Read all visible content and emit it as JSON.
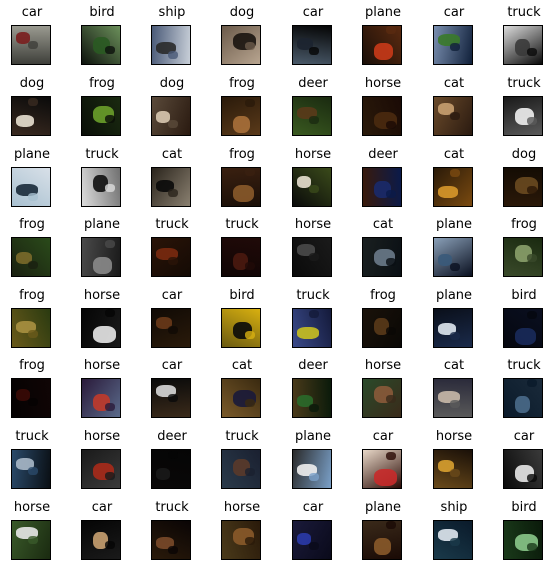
{
  "images": [
    {
      "label": "car",
      "colors": [
        "#3e3f3a",
        "#7a1e1e",
        "#9a9a90"
      ]
    },
    {
      "label": "bird",
      "colors": [
        "#0d120d",
        "#2a5a22",
        "#6b8f5a"
      ]
    },
    {
      "label": "ship",
      "colors": [
        "#4a5a78",
        "#2a2a2a",
        "#c8cfd8"
      ]
    },
    {
      "label": "dog",
      "colors": [
        "#6b5a4a",
        "#1a1410",
        "#b8a590"
      ]
    },
    {
      "label": "car",
      "colors": [
        "#050505",
        "#1c2430",
        "#4a5a6a"
      ]
    },
    {
      "label": "plane",
      "colors": [
        "#5a2a10",
        "#c83a18",
        "#1a0f08"
      ]
    },
    {
      "label": "car",
      "colors": [
        "#10203a",
        "#3a7a2a",
        "#7a8fb0"
      ]
    },
    {
      "label": "truck",
      "colors": [
        "#0a0a0a",
        "#3a3a3a",
        "#dcdcdc"
      ]
    },
    {
      "label": "dog",
      "colors": [
        "#3a2a20",
        "#e8e0d0",
        "#0a0a0a"
      ]
    },
    {
      "label": "frog",
      "colors": [
        "#0a0f08",
        "#6aa02a",
        "#1a2a10"
      ]
    },
    {
      "label": "dog",
      "colors": [
        "#5a4a3a",
        "#d8c8b0",
        "#2a1a10"
      ]
    },
    {
      "label": "frog",
      "colors": [
        "#2a1a0a",
        "#a8703a",
        "#5a3a1a"
      ]
    },
    {
      "label": "deer",
      "colors": [
        "#1a2a10",
        "#5a3a1a",
        "#3a5a20"
      ]
    },
    {
      "label": "horse",
      "colors": [
        "#1a0a05",
        "#4a2a10",
        "#2a1a0a"
      ]
    },
    {
      "label": "cat",
      "colors": [
        "#2a1a10",
        "#c8a070",
        "#6a4a2a"
      ]
    },
    {
      "label": "truck",
      "colors": [
        "#5a5a5a",
        "#f0f0f0",
        "#1a1a1a"
      ]
    },
    {
      "label": "plane",
      "colors": [
        "#a8c0d0",
        "#1a2a3a",
        "#d8e0e8"
      ]
    },
    {
      "label": "truck",
      "colors": [
        "#dcdcdc",
        "#101010",
        "#707070"
      ]
    },
    {
      "label": "cat",
      "colors": [
        "#2a241c",
        "#0a0a0a",
        "#8a8070"
      ]
    },
    {
      "label": "frog",
      "colors": [
        "#3a2010",
        "#8a5a2a",
        "#1a0f08"
      ]
    },
    {
      "label": "horse",
      "colors": [
        "#3a4a1a",
        "#e8e0d0",
        "#0a0a0a"
      ]
    },
    {
      "label": "deer",
      "colors": [
        "#0a1a4a",
        "#1a2a6a",
        "#3a1a0a"
      ]
    },
    {
      "label": "cat",
      "colors": [
        "#7a4a10",
        "#d8982a",
        "#2a1a08"
      ]
    },
    {
      "label": "dog",
      "colors": [
        "#2a1808",
        "#6a4a20",
        "#140c04"
      ]
    },
    {
      "label": "frog",
      "colors": [
        "#1a2010",
        "#7a6a2a",
        "#2a4a1a"
      ]
    },
    {
      "label": "plane",
      "colors": [
        "#4a4a4a",
        "#8a8a8a",
        "#1a1a1a"
      ]
    },
    {
      "label": "truck",
      "colors": [
        "#2a1408",
        "#7a2a10",
        "#140a04"
      ]
    },
    {
      "label": "truck",
      "colors": [
        "#200a08",
        "#4a1a10",
        "#100505"
      ]
    },
    {
      "label": "horse",
      "colors": [
        "#1a1a1a",
        "#4a4a4a",
        "#0a0a0a"
      ]
    },
    {
      "label": "cat",
      "colors": [
        "#0a0f14",
        "#6a7a8a",
        "#1a2020"
      ]
    },
    {
      "label": "plane",
      "colors": [
        "#0a1020",
        "#3a5a7a",
        "#8aa0b8"
      ]
    },
    {
      "label": "frog",
      "colors": [
        "#3a4a2a",
        "#8aa06a",
        "#1a2a10"
      ]
    },
    {
      "label": "frog",
      "colors": [
        "#6a5a1a",
        "#a89040",
        "#2a3a10"
      ]
    },
    {
      "label": "horse",
      "colors": [
        "#050505",
        "#e8e8e8",
        "#1a1a1a"
      ]
    },
    {
      "label": "car",
      "colors": [
        "#100a05",
        "#6a3a1a",
        "#2a1a0a"
      ]
    },
    {
      "label": "bird",
      "colors": [
        "#d8b010",
        "#0a0a0a",
        "#6a5a10"
      ]
    },
    {
      "label": "truck",
      "colors": [
        "#141a3a",
        "#c8c020",
        "#3a4a8a"
      ]
    },
    {
      "label": "frog",
      "colors": [
        "#0a0805",
        "#5a3a1a",
        "#1a120a"
      ]
    },
    {
      "label": "plane",
      "colors": [
        "#1a2a4a",
        "#e0e8f0",
        "#0a0f1a"
      ]
    },
    {
      "label": "bird",
      "colors": [
        "#05070f",
        "#1a2a5a",
        "#0a0f20"
      ]
    },
    {
      "label": "frog",
      "colors": [
        "#050202",
        "#3a0a05",
        "#100505"
      ]
    },
    {
      "label": "horse",
      "colors": [
        "#2a1a3a",
        "#c03a2a",
        "#5a6a8a"
      ]
    },
    {
      "label": "car",
      "colors": [
        "#0a0a0a",
        "#d8d8d8",
        "#3a2a1a"
      ]
    },
    {
      "label": "cat",
      "colors": [
        "#3a2a10",
        "#1a1a3a",
        "#7a5a2a"
      ]
    },
    {
      "label": "deer",
      "colors": [
        "#0a1a0a",
        "#2a6a2a",
        "#4a3a1a"
      ]
    },
    {
      "label": "horse",
      "colors": [
        "#3a2a1a",
        "#8a5a3a",
        "#2a4a2a"
      ]
    },
    {
      "label": "cat",
      "colors": [
        "#5a5a5a",
        "#c8b8a8",
        "#2a2a3a"
      ]
    },
    {
      "label": "truck",
      "colors": [
        "#0a1a2a",
        "#4a6a8a",
        "#1a2a3a"
      ]
    },
    {
      "label": "truck",
      "colors": [
        "#2a4a6a",
        "#a8b8c8",
        "#0a0f14"
      ]
    },
    {
      "label": "horse",
      "colors": [
        "#1a1a1a",
        "#a82a1a",
        "#3a3a3a"
      ]
    },
    {
      "label": "deer",
      "colors": [
        "#050505",
        "#1a1a1a",
        "#0a0808"
      ]
    },
    {
      "label": "truck",
      "colors": [
        "#1a2030",
        "#5a3a2a",
        "#2a3a4a"
      ]
    },
    {
      "label": "plane",
      "colors": [
        "#7aa0c8",
        "#f0f0f0",
        "#2a2a2a"
      ]
    },
    {
      "label": "car",
      "colors": [
        "#2a0a05",
        "#c82a2a",
        "#e8d8c8"
      ]
    },
    {
      "label": "horse",
      "colors": [
        "#6a4a1a",
        "#d8a030",
        "#1a1008"
      ]
    },
    {
      "label": "car",
      "colors": [
        "#0a0a0a",
        "#e8e8e8",
        "#3a3a3a"
      ]
    },
    {
      "label": "horse",
      "colors": [
        "#3a5a2a",
        "#e8e8e8",
        "#1a2a10"
      ]
    },
    {
      "label": "car",
      "colors": [
        "#050505",
        "#c8a070",
        "#1a1a1a"
      ]
    },
    {
      "label": "truck",
      "colors": [
        "#0a0505",
        "#7a4a2a",
        "#2a1a0a"
      ]
    },
    {
      "label": "horse",
      "colors": [
        "#2a1a0a",
        "#8a5a2a",
        "#4a3a1a"
      ]
    },
    {
      "label": "car",
      "colors": [
        "#0a0a1a",
        "#2a3aa8",
        "#1a1a3a"
      ]
    },
    {
      "label": "plane",
      "colors": [
        "#1a0a05",
        "#8a5a2a",
        "#3a2a1a"
      ]
    },
    {
      "label": "ship",
      "colors": [
        "#1a3a4a",
        "#e0e8f0",
        "#0a1a2a"
      ]
    },
    {
      "label": "bird",
      "colors": [
        "#1a3a1a",
        "#8ac88a",
        "#0a1a0a"
      ]
    }
  ]
}
